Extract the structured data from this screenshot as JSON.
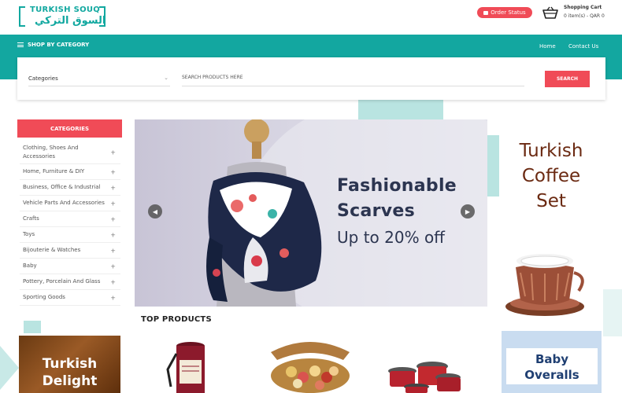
{
  "header": {
    "logo_en": "TURKISH SOUQ",
    "logo_ar": "السوق التركي",
    "order_status_label": "Order Status",
    "cart_title": "Shopping Cart",
    "cart_info": "0 item(s) - QAR 0"
  },
  "nav": {
    "shop_by_category": "SHOP BY CATEGORY",
    "links": [
      "Home",
      "Contact Us"
    ]
  },
  "search": {
    "category_select_value": "Categories",
    "placeholder": "SEARCH PRODUCTS HERE",
    "button_label": "SEARCH"
  },
  "sidebar": {
    "header": "CATEGORIES",
    "items": [
      {
        "label": "Clothing, Shoes And Accessories"
      },
      {
        "label": "Home, Furniture & DIY"
      },
      {
        "label": "Business, Office & Industrial"
      },
      {
        "label": "Vehicle Parts And Accessories"
      },
      {
        "label": "Crafts"
      },
      {
        "label": "Toys"
      },
      {
        "label": "Bijouterie & Watches"
      },
      {
        "label": "Baby"
      },
      {
        "label": "Pottery, Porcelain And Glass"
      },
      {
        "label": "Sporting Goods"
      }
    ],
    "expand_symbol": "+"
  },
  "slider": {
    "line1": "Fashionable",
    "line2": "Scarves",
    "line3": "Up to 20% off",
    "prev_icon": "chevron-left-icon",
    "next_icon": "chevron-right-icon"
  },
  "promo_banners": {
    "coffee_line1": "Turkish",
    "coffee_line2": "Coffee",
    "coffee_line3": "Set",
    "delight_line1": "Turkish",
    "delight_line2": "Delight",
    "overalls_line1": "Baby",
    "overalls_line2": "Overalls"
  },
  "products": {
    "section_title": "TOP PRODUCTS"
  },
  "colors": {
    "teal": "#13a7a0",
    "accent_red": "#f04b57",
    "light_teal": "#b9e4e1"
  }
}
